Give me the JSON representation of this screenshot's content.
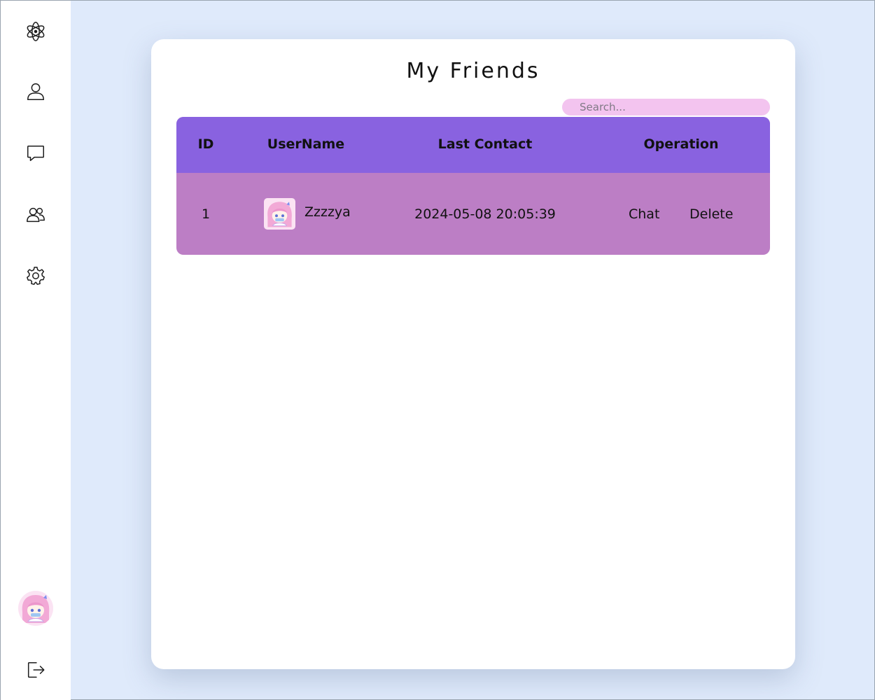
{
  "page": {
    "title": "My Friends"
  },
  "search": {
    "placeholder": "Search..."
  },
  "table": {
    "headers": [
      "ID",
      "UserName",
      "Last Contact",
      "Operation"
    ],
    "rows": [
      {
        "id": "1",
        "username": "Zzzzya",
        "last_contact": "2024-05-08 20:05:39",
        "actions": [
          "Chat",
          "Delete"
        ]
      }
    ]
  },
  "sidebar": {
    "items": [
      {
        "icon": "electron-logo-icon"
      },
      {
        "icon": "user-icon"
      },
      {
        "icon": "chat-icon"
      },
      {
        "icon": "group-icon"
      },
      {
        "icon": "gear-icon"
      },
      {
        "icon": "avatar"
      },
      {
        "icon": "logout-icon"
      }
    ]
  },
  "colors": {
    "background": "#dfeafb",
    "header": "#8962e0",
    "row": "#bc7ec5",
    "search": "#f3c4ef"
  }
}
